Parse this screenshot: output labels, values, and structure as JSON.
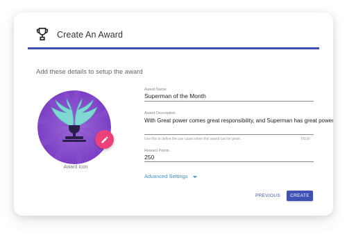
{
  "header": {
    "title": "Create An Award",
    "icon": "trophy-icon",
    "accent_color": "#3f51b5"
  },
  "subtitle": "Add these details to setup the award",
  "award_icon": {
    "caption": "Award Icon",
    "image": "winged-trophy",
    "edit_icon": "pencil-icon",
    "edit_button_color": "#ec407a"
  },
  "form": {
    "name": {
      "label": "Award Name",
      "value": "Superman of the Month"
    },
    "description": {
      "label": "Award Description",
      "value": "With Great power comes great responsibility, and Superman has great power.",
      "hint": "Use this to define the use cases when this award can be given.",
      "counter": "0/100"
    },
    "points": {
      "label": "Reward Points",
      "value": "250"
    },
    "advanced_label": "Advanced Settings"
  },
  "actions": {
    "previous_label": "PREVIOUS",
    "create_label": "CREATE"
  }
}
